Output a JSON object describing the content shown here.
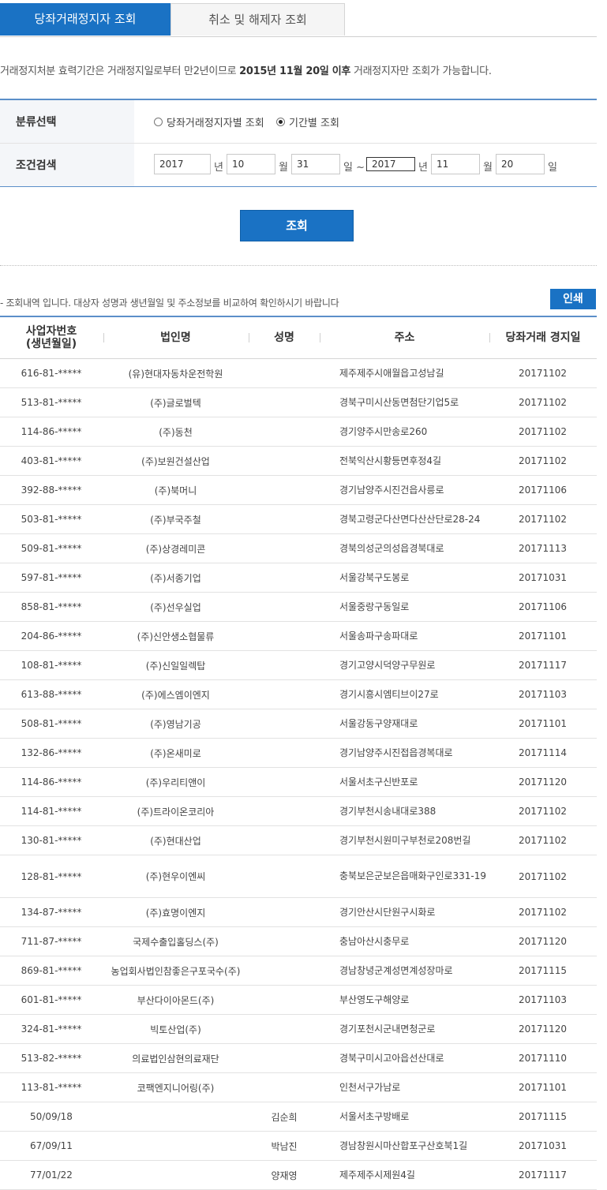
{
  "tabs": [
    {
      "label": "당좌거래정지자 조회",
      "active": true
    },
    {
      "label": "취소 및 해제자 조회",
      "active": false
    }
  ],
  "notice": {
    "pre": "거래정지처분 효력기간은 거래정지일로부터 만2년이므로 ",
    "bold": "2015년 11월 20일 이후",
    "post": " 거래정지자만 조회가 가능합니다."
  },
  "form": {
    "category_label": "분류선택",
    "radio_person": "당좌거래정지자별 조회",
    "radio_period": "기간별 조회",
    "selected_radio": "period",
    "condition_label": "조건검색",
    "from_year": "2017",
    "from_month": "10",
    "from_day": "31",
    "to_year": "2017",
    "to_month": "11",
    "to_day": "20",
    "unit_year": "년",
    "unit_month": "월",
    "unit_day": "일",
    "range_sep": "일 ~"
  },
  "search_button": "조회",
  "result_note": "- 조회내역 입니다. 대상자 성명과 생년월일 및 주소정보를 비교하여 확인하시기 바랍니다",
  "print_button": "인쇄",
  "table": {
    "headers": [
      "사업자번호\n(생년월일)",
      "법인명",
      "성명",
      "주소",
      "당좌거래 경지일"
    ],
    "rows": [
      {
        "num": "616-81-*****",
        "corp": "(유)현대자동차운전학원",
        "name": "",
        "addr": "제주제주시애월읍고성남길",
        "date": "20171102"
      },
      {
        "num": "513-81-*****",
        "corp": "(주)글로벌텍",
        "name": "",
        "addr": "경북구미시산동면첨단기업5로",
        "date": "20171102"
      },
      {
        "num": "114-86-*****",
        "corp": "(주)동천",
        "name": "",
        "addr": "경기양주시만송로260",
        "date": "20171102"
      },
      {
        "num": "403-81-*****",
        "corp": "(주)보원건설산업",
        "name": "",
        "addr": "전북익산시황등면후정4길",
        "date": "20171102"
      },
      {
        "num": "392-88-*****",
        "corp": "(주)북머니",
        "name": "",
        "addr": "경기남양주시진건읍사릉로",
        "date": "20171106"
      },
      {
        "num": "503-81-*****",
        "corp": "(주)부국주철",
        "name": "",
        "addr": "경북고령군다산면다산산단로28-24",
        "date": "20171102"
      },
      {
        "num": "509-81-*****",
        "corp": "(주)상경레미콘",
        "name": "",
        "addr": "경북의성군의성읍경북대로",
        "date": "20171113"
      },
      {
        "num": "597-81-*****",
        "corp": "(주)서종기업",
        "name": "",
        "addr": "서울강북구도봉로",
        "date": "20171031"
      },
      {
        "num": "858-81-*****",
        "corp": "(주)선우실업",
        "name": "",
        "addr": "서울중랑구동일로",
        "date": "20171106"
      },
      {
        "num": "204-86-*****",
        "corp": "(주)신안생소협물류",
        "name": "",
        "addr": "서울송파구송파대로",
        "date": "20171101"
      },
      {
        "num": "108-81-*****",
        "corp": "(주)신일일렉탑",
        "name": "",
        "addr": "경기고양시덕양구무원로",
        "date": "20171117"
      },
      {
        "num": "613-88-*****",
        "corp": "(주)에스엠이엔지",
        "name": "",
        "addr": "경기시흥시엠티브이27로",
        "date": "20171103"
      },
      {
        "num": "508-81-*****",
        "corp": "(주)영남기공",
        "name": "",
        "addr": "서울강동구양재대로",
        "date": "20171101"
      },
      {
        "num": "132-86-*****",
        "corp": "(주)온새미로",
        "name": "",
        "addr": "경기남양주시진접읍경복대로",
        "date": "20171114"
      },
      {
        "num": "114-86-*****",
        "corp": "(주)우리티앤이",
        "name": "",
        "addr": "서울서초구신반포로",
        "date": "20171120"
      },
      {
        "num": "114-81-*****",
        "corp": "(주)트라이온코리아",
        "name": "",
        "addr": "경기부천시송내대로388",
        "date": "20171102"
      },
      {
        "num": "130-81-*****",
        "corp": "(주)현대산업",
        "name": "",
        "addr": "경기부천시원미구부천로208번길",
        "date": "20171102"
      },
      {
        "num": "128-81-*****",
        "corp": "(주)현우이엔씨",
        "name": "",
        "addr": "충북보은군보은읍매화구인로331-19",
        "date": "20171102",
        "tall": true
      },
      {
        "num": "134-87-*****",
        "corp": "(주)효명이엔지",
        "name": "",
        "addr": "경기안산시단원구시화로",
        "date": "20171102"
      },
      {
        "num": "711-87-*****",
        "corp": "국제수출입홀딩스(주)",
        "name": "",
        "addr": "충남아산시충무로",
        "date": "20171120"
      },
      {
        "num": "869-81-*****",
        "corp": "농업회사법인참좋은구포국수(주)",
        "name": "",
        "addr": "경남창녕군계성면계성장마로",
        "date": "20171115"
      },
      {
        "num": "601-81-*****",
        "corp": "부산다이아몬드(주)",
        "name": "",
        "addr": "부산영도구해양로",
        "date": "20171103"
      },
      {
        "num": "324-81-*****",
        "corp": "빅토산업(주)",
        "name": "",
        "addr": "경기포천시군내면청군로",
        "date": "20171120"
      },
      {
        "num": "513-82-*****",
        "corp": "의료법인삼현의료재단",
        "name": "",
        "addr": "경북구미시고아읍선산대로",
        "date": "20171110"
      },
      {
        "num": "113-81-*****",
        "corp": "코팩엔지니어링(주)",
        "name": "",
        "addr": "인천서구가남로",
        "date": "20171101"
      },
      {
        "num": "50/09/18",
        "corp": "",
        "name": "김순희",
        "addr": "서울서초구방배로",
        "date": "20171115"
      },
      {
        "num": "67/09/11",
        "corp": "",
        "name": "박남진",
        "addr": "경남창원시마산합포구산호북1길",
        "date": "20171031"
      },
      {
        "num": "77/01/22",
        "corp": "",
        "name": "양재영",
        "addr": "제주제주시제원4길",
        "date": "20171117"
      }
    ]
  }
}
